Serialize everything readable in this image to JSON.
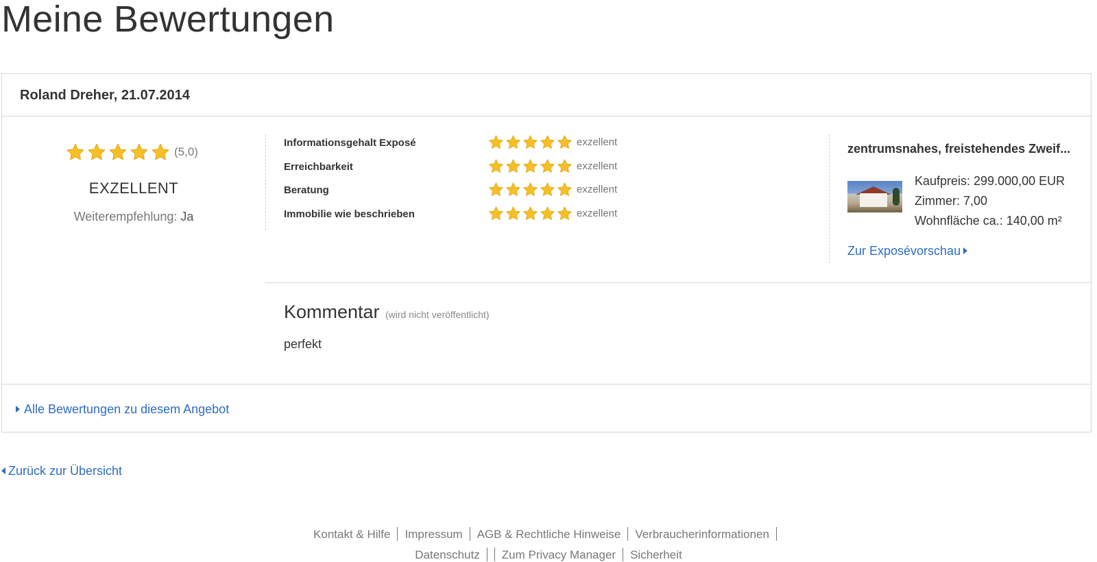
{
  "page": {
    "title": "Meine Bewertungen"
  },
  "review": {
    "author_date": "Roland Dreher, 21.07.2014",
    "overall": {
      "stars": 5,
      "score_text": "(5,0)",
      "label": "EXZELLENT",
      "recommend_label": "Weiterempfehlung:",
      "recommend_value": "Ja"
    },
    "categories": [
      {
        "label": "Informationsgehalt Exposé",
        "stars": 5,
        "text": "exzellent"
      },
      {
        "label": "Erreichbarkeit",
        "stars": 5,
        "text": "exzellent"
      },
      {
        "label": "Beratung",
        "stars": 5,
        "text": "exzellent"
      },
      {
        "label": "Immobilie wie beschrieben",
        "stars": 5,
        "text": "exzellent"
      }
    ],
    "listing": {
      "title": "zentrumsnahes, freistehendes Zweif...",
      "price": "Kaufpreis: 299.000,00 EUR",
      "rooms": "Zimmer: 7,00",
      "area": "Wohnfläche ca.: 140,00 m²",
      "link_label": "Zur Exposévorschau"
    },
    "comment": {
      "title": "Kommentar",
      "note": "(wird nicht veröffentlicht)",
      "text": "perfekt"
    },
    "all_ratings_link": "Alle Bewertungen zu diesem Angebot"
  },
  "back_link": "Zurück zur Übersicht",
  "footer": {
    "links_row1": [
      "Kontakt & Hilfe",
      "Impressum",
      "AGB & Rechtliche Hinweise",
      "Verbraucherinformationen"
    ],
    "links_row2": [
      "Datenschutz",
      "Zum Privacy Manager",
      "Sicherheit"
    ]
  },
  "colors": {
    "star": "#f6bf26",
    "star_stroke": "#e0a514",
    "link": "#2d6cc0",
    "border": "#d6d6d6"
  },
  "icons": {
    "star": "star-icon",
    "caret_right": "caret-right-icon",
    "caret_left": "caret-left-icon"
  }
}
